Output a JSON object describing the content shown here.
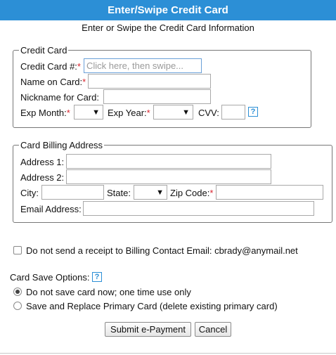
{
  "window": {
    "title": "Enter/Swipe Credit Card",
    "subtitle": "Enter or Swipe the Credit Card Information"
  },
  "credit_card": {
    "legend": "Credit Card",
    "card_number_label": "Credit Card #:",
    "card_number_placeholder": "Click here, then swipe...",
    "name_label": "Name on Card:",
    "nickname_label": "Nickname for Card:",
    "exp_month_label": "Exp Month:",
    "exp_year_label": "Exp Year:",
    "cvv_label": "CVV:",
    "required_mark": "*",
    "help_glyph": "?"
  },
  "billing": {
    "legend": "Card Billing Address",
    "address1_label": "Address 1:",
    "address2_label": "Address 2:",
    "city_label": "City:",
    "state_label": "State:",
    "zip_label": "Zip Code:",
    "email_label": "Email Address:",
    "required_mark": "*"
  },
  "receipt_checkbox_label": "Do not send a receipt to Billing Contact Email: cbrady@anymail.net",
  "save_options": {
    "label": "Card Save Options:",
    "help_glyph": "?",
    "options": [
      {
        "label": "Do not save card now; one time use only",
        "selected": true
      },
      {
        "label": "Save and Replace Primary Card (delete existing primary card)",
        "selected": false
      }
    ]
  },
  "buttons": {
    "submit": "Submit e-Payment",
    "cancel": "Cancel"
  },
  "dropdown_arrow_glyph": "▼",
  "colors": {
    "title_bar": "#2c8fd6",
    "required": "#d9242f",
    "focus_border": "#6aa0d8"
  }
}
